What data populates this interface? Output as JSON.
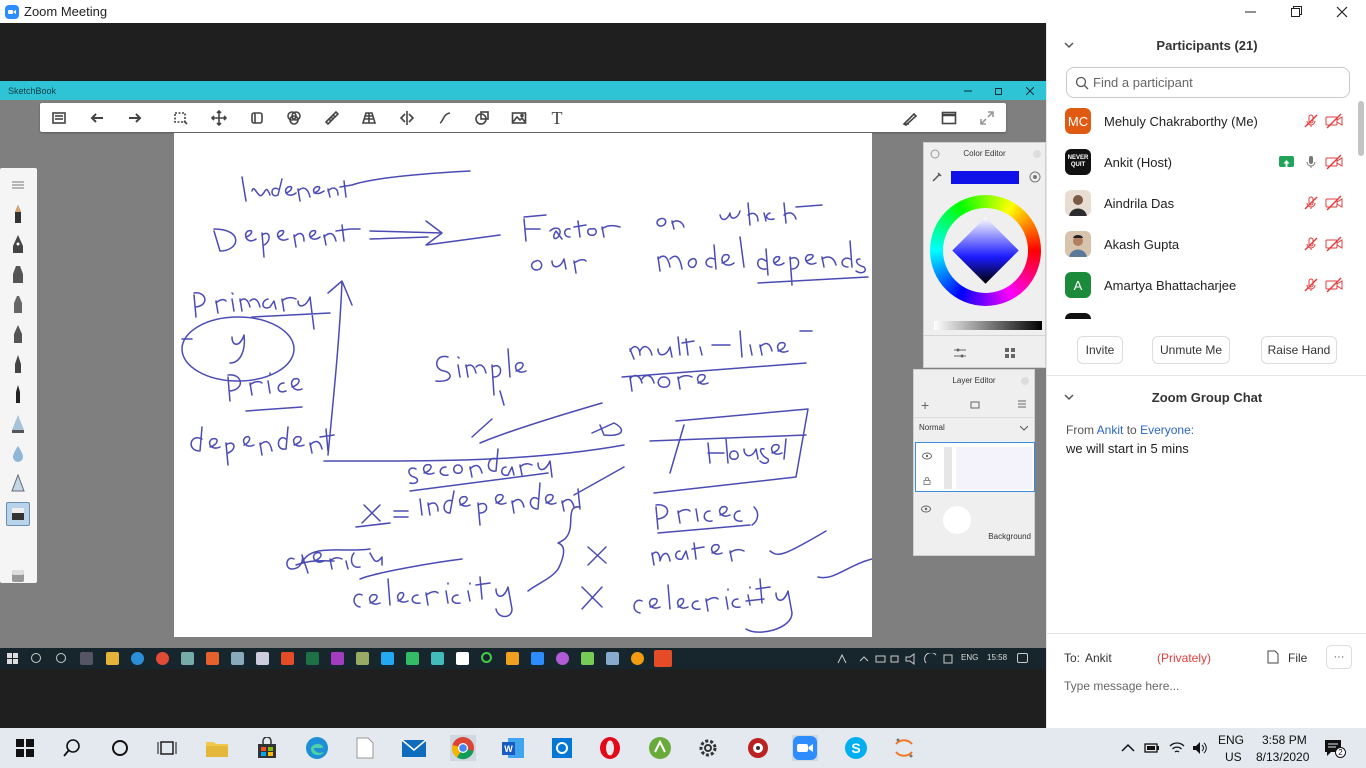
{
  "window": {
    "title": "Zoom Meeting"
  },
  "sketchbook": {
    "title": "SketchBook",
    "color_editor_title": "Color Editor",
    "layer_editor_title": "Layer Editor",
    "blend_mode": "Normal",
    "background_layer": "Background",
    "current_color": "#1010e8"
  },
  "inner_taskbar": {
    "lang": "ENG",
    "time": "15:58"
  },
  "participants": {
    "header": "Participants (21)",
    "search_placeholder": "Find a participant",
    "list": [
      {
        "initials": "MC",
        "name": "Mehuly Chakraborthy (Me)",
        "avatar_color": "#e05a12"
      },
      {
        "initials": "NEVER QUIT",
        "name": "Ankit (Host)",
        "avatar_color": "#111111"
      },
      {
        "initials": "",
        "name": "Aindrila Das",
        "avatar_color": "#d9c7b8"
      },
      {
        "initials": "",
        "name": "Akash Gupta",
        "avatar_color": "#c7a98d"
      },
      {
        "initials": "A",
        "name": "Amartya Bhattacharjee",
        "avatar_color": "#1b8a3a"
      }
    ],
    "buttons": {
      "invite": "Invite",
      "unmute": "Unmute Me",
      "raise_hand": "Raise Hand"
    }
  },
  "chat": {
    "header": "Zoom Group Chat",
    "from_label": "From",
    "from_name": "Ankit",
    "to_label": "to",
    "to_name": "Everyone:",
    "message": "we will start in 5 mins",
    "recipient_label": "To:",
    "recipient": "Ankit",
    "privately": "(Privately)",
    "file_label": "File",
    "more_label": "···",
    "input_placeholder": "Type message here..."
  },
  "taskbar": {
    "lang_top": "ENG",
    "lang_bottom": "US",
    "time": "3:58 PM",
    "date": "8/13/2020",
    "notifications": "2"
  },
  "colors": {
    "zoom_blue": "#2d8cff",
    "sketch_teal": "#2ec4d6",
    "muted_red": "#e23b3b"
  }
}
